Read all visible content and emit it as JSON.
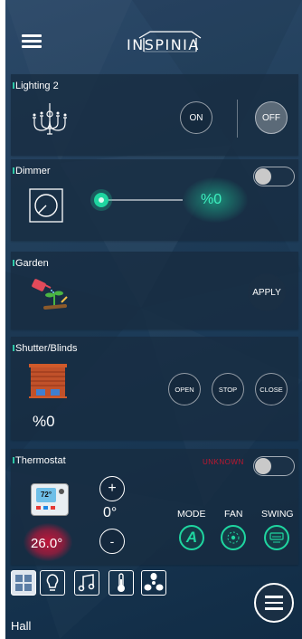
{
  "header": {
    "logo_text": "INSPINIA",
    "menu_icon": "hamburger-menu-icon"
  },
  "cards": {
    "lighting": {
      "title": "Lighting 2",
      "icon": "chandelier-icon",
      "on_label": "ON",
      "off_label": "OFF",
      "active": "OFF"
    },
    "dimmer": {
      "title": "Dimmer",
      "icon": "dimmer-knob-icon",
      "value": "%0",
      "level": 0,
      "toggle_on": false
    },
    "garden": {
      "title": "Garden",
      "icon": "watering-can-plant-icon",
      "apply_label": "APPLY"
    },
    "shutter": {
      "title": "Shutter/Blinds",
      "icon": "shutter-blinds-icon",
      "value": "%0",
      "open_label": "OPEN",
      "stop_label": "STOP",
      "close_label": "CLOSE"
    },
    "thermostat": {
      "title": "Thermostat",
      "icon": "thermostat-device-icon",
      "icon_text": "72°",
      "status_text": "UNKNOWN",
      "toggle_on": false,
      "setpoint": "0°",
      "plus_label": "+",
      "minus_label": "-",
      "current_temp": "26.0°",
      "mode_label": "MODE",
      "fan_label": "FAN",
      "swing_label": "SWING",
      "mode_value": "A"
    }
  },
  "bottom_nav": {
    "tabs": [
      {
        "name": "grid-icon",
        "active": true
      },
      {
        "name": "lightbulb-icon",
        "active": false
      },
      {
        "name": "music-note-icon",
        "active": false
      },
      {
        "name": "thermometer-icon",
        "active": false
      },
      {
        "name": "fan-icon",
        "active": false
      }
    ],
    "room_label": "Hall",
    "menu_icon": "circle-menu-icon"
  },
  "colors": {
    "accent_green": "#1fd6a0",
    "temp_red": "#c8153a",
    "unknown_red": "#c0172f"
  }
}
